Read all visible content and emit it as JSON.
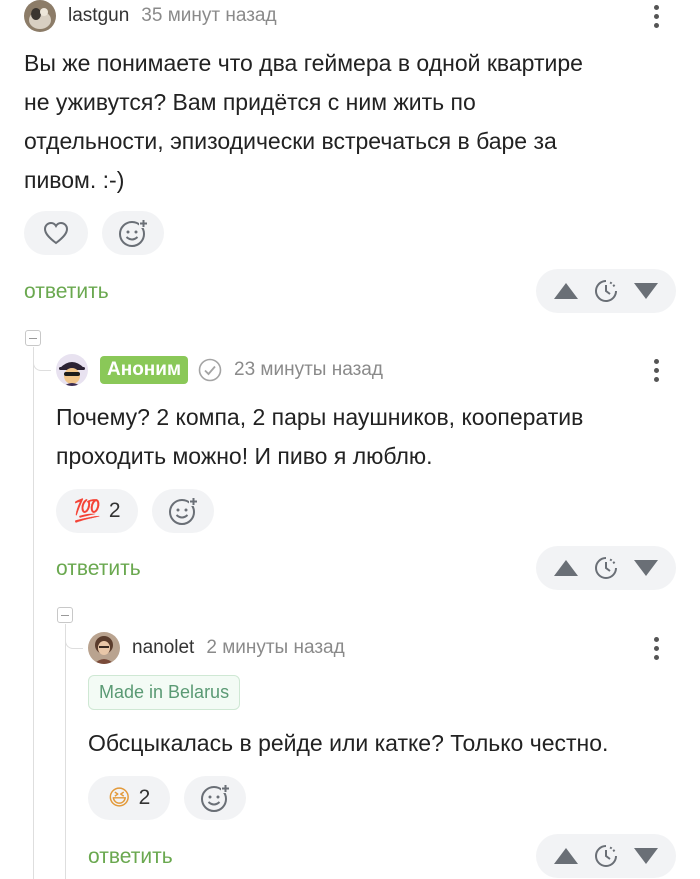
{
  "comments": [
    {
      "username": "lastgun",
      "time": "35 минут назад",
      "text_lines": [
        "Вы же понимаете что два геймера в одной квартире",
        "не уживутся? Вам придётся с ним жить по",
        "отдельности, эпизодически встречаться в баре за",
        "пивом. :-)"
      ],
      "reply_label": "ответить"
    },
    {
      "badge": "Аноним",
      "time": "23 минуты назад",
      "text_lines": [
        "Почему? 2 компа, 2 пары наушников, кооператив",
        "проходить можно! И пиво я люблю."
      ],
      "reaction_emoji": "💯",
      "reaction_count": "2",
      "reply_label": "ответить"
    },
    {
      "username": "nanolet",
      "time": "2 минуты назад",
      "tag": "Made in Belarus",
      "text_lines": [
        "Обсцыкалась в рейде или катке? Только честно."
      ],
      "reaction_emoji": "😆",
      "reaction_count": "2",
      "reply_label": "ответить"
    }
  ],
  "colors": {
    "reply_green": "#6aa84f",
    "anon_badge": "#8ac858",
    "pill_bg": "#f2f3f5"
  },
  "icons": [
    "heart-icon",
    "add-emoji-icon",
    "upvote-icon",
    "later-icon",
    "downvote-icon",
    "kebab-menu-icon",
    "verified-check-icon",
    "collapse-icon"
  ]
}
